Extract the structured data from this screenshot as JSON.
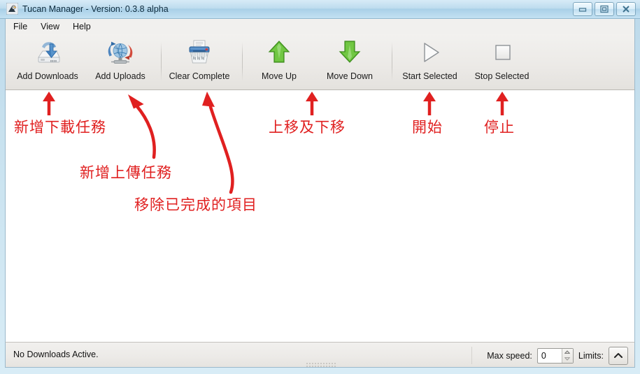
{
  "window": {
    "title": "Tucan Manager - Version: 0.3.8 alpha",
    "icon": "tucan-app-icon",
    "controls": [
      {
        "name": "minimize-button",
        "glyph": "minimize-icon"
      },
      {
        "name": "maximize-button",
        "glyph": "maximize-icon"
      },
      {
        "name": "close-button",
        "glyph": "close-icon"
      }
    ]
  },
  "menubar": {
    "items": [
      {
        "label": "File"
      },
      {
        "label": "View"
      },
      {
        "label": "Help"
      }
    ]
  },
  "toolbar": {
    "buttons": [
      {
        "label": "Add Downloads",
        "icon": "download-to-drive-icon"
      },
      {
        "label": "Add Uploads",
        "icon": "globe-transfer-icon"
      },
      {
        "label": "Clear Complete",
        "icon": "paper-shredder-icon"
      },
      {
        "label": "Move Up",
        "icon": "green-up-arrow-icon"
      },
      {
        "label": "Move Down",
        "icon": "green-down-arrow-icon"
      },
      {
        "label": "Start Selected",
        "icon": "play-triangle-icon"
      },
      {
        "label": "Stop Selected",
        "icon": "stop-square-icon"
      }
    ]
  },
  "annotations": {
    "color": "#e02020",
    "items": [
      {
        "text": "新增下載任務",
        "target": "Add Downloads"
      },
      {
        "text": "新增上傳任務",
        "target": "Add Uploads"
      },
      {
        "text": "移除已完成的項目",
        "target": "Clear Complete"
      },
      {
        "text": "上移及下移",
        "target": "Move Up / Move Down"
      },
      {
        "text": "開始",
        "target": "Start Selected"
      },
      {
        "text": "停止",
        "target": "Stop Selected"
      }
    ]
  },
  "statusbar": {
    "status_text": "No Downloads Active.",
    "max_speed_label": "Max speed:",
    "max_speed_value": "0",
    "limits_label": "Limits:",
    "limits_button_icon": "chevron-up-icon"
  }
}
